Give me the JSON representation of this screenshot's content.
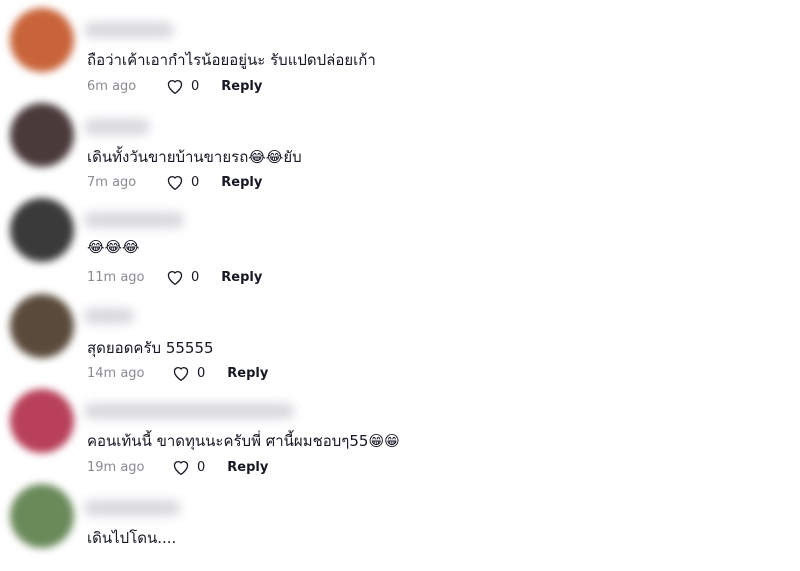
{
  "comments": [
    {
      "text": "ถือว่าเค้าเอากำไรน้อยอยู่นะ รับแปดปล่อยเก้า",
      "time": "6m ago",
      "likes": "0",
      "reply": "Reply",
      "avatar_color": "#c9643a"
    },
    {
      "text": "เดินทั้งวันขายบ้านขายรถ😂😂ยับ",
      "time": "7m ago",
      "likes": "0",
      "reply": "Reply",
      "avatar_color": "#4a3a3a"
    },
    {
      "text": "😂😂😂",
      "time": "11m ago",
      "likes": "0",
      "reply": "Reply",
      "avatar_color": "#3a3a3a"
    },
    {
      "text": "สุดยอดครับ 55555",
      "time": "14m ago",
      "likes": "0",
      "reply": "Reply",
      "avatar_color": "#5a4a3a"
    },
    {
      "text": "คอนเท้นนี้ ขาดทุนนะครับพี่ ศานี้ผมชอบๆ55😁😁",
      "time": "19m ago",
      "likes": "0",
      "reply": "Reply",
      "avatar_color": "#b8405a"
    },
    {
      "text": "เดินไปโดน....",
      "time": "",
      "likes": "",
      "reply": "",
      "avatar_color": "#6a8a5a"
    }
  ]
}
